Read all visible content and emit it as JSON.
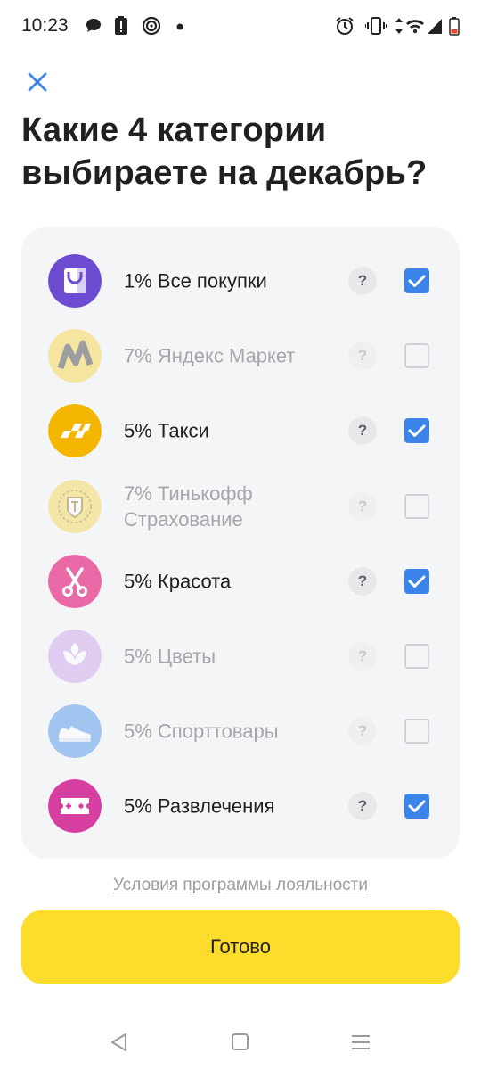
{
  "status_bar": {
    "time": "10:23",
    "icons": [
      "message-icon",
      "battery-alert-icon",
      "sync-icon",
      "dot-icon",
      "alarm-icon",
      "vibrate-icon",
      "wifi-icon",
      "signal-icon",
      "battery-icon"
    ]
  },
  "header": {
    "title": "Какие 4 категории выбираете на декабрь?"
  },
  "categories": [
    {
      "label": "1% Все покупки",
      "icon": "shopping-bag-icon",
      "selected": true
    },
    {
      "label": "7% Яндекс Маркет",
      "icon": "yandex-market-icon",
      "selected": false
    },
    {
      "label": "5% Такси",
      "icon": "taxi-icon",
      "selected": true
    },
    {
      "label": "7% Тинькофф Страхование",
      "icon": "tinkoff-insurance-icon",
      "selected": false
    },
    {
      "label": "5% Красота",
      "icon": "scissors-icon",
      "selected": true
    },
    {
      "label": "5% Цветы",
      "icon": "flower-icon",
      "selected": false
    },
    {
      "label": "5% Спорттовары",
      "icon": "sneaker-icon",
      "selected": false
    },
    {
      "label": "5% Развлечения",
      "icon": "ticket-icon",
      "selected": true
    }
  ],
  "help_label": "?",
  "terms_link": "Условия программы лояльности",
  "done_button": "Готово",
  "nav_bar": {
    "icons": [
      "back-icon",
      "home-icon",
      "menu-icon"
    ]
  },
  "colors": {
    "accent_yellow": "#fddd2c",
    "checkbox_blue": "#3d84ea",
    "card_bg": "#f4f5f7"
  }
}
